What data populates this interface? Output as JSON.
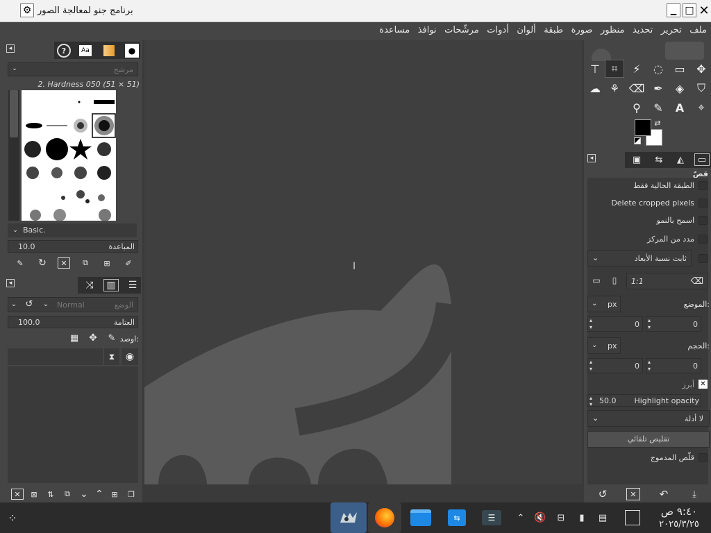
{
  "window": {
    "title": "برنامج جنو لمعالجة الصور"
  },
  "menu": [
    "ملف",
    "تحرير",
    "تحديد",
    "منظور",
    "صورة",
    "طبقة",
    "ألوان",
    "أدوات",
    "مرشّحات",
    "نوافذ",
    "مساعدة"
  ],
  "brushes": {
    "filter_placeholder": "مرشح",
    "selected_name": "2. Hardness 050 (51 × 51)",
    "preset": "Basic.",
    "spacing_label": "المباعدة",
    "spacing_value": "10.0"
  },
  "layers": {
    "mode_placeholder": "الوضع",
    "mode_value": "Normal",
    "opacity_label": "العتامة",
    "opacity_value": "100.0",
    "lock_label": "اوصد:"
  },
  "tool_options": {
    "title": "قصّ",
    "current_layer_only": "الطبقة الحالية فقط",
    "delete_cropped": "Delete cropped pixels",
    "allow_growing": "اسمح بالنمو",
    "expand_center": "مدد من المركز",
    "fixed_label": "ثابت نسبة الأبعاد",
    "ratio_value": "1:1",
    "position_label": "الموضع:",
    "size_label": "الحجم:",
    "unit": "px",
    "pos_x": "0",
    "pos_y": "0",
    "size_w": "0",
    "size_h": "0",
    "highlight_label": "أبرز",
    "highlight_opacity_label": "Highlight opacity",
    "highlight_opacity_value": "50.0",
    "guides": "لا أدلة",
    "auto_shrink": "تقليص تلقائي",
    "shrink_merged": "قلّص المدموج"
  },
  "taskbar": {
    "time": "٩:٤٠ ص",
    "date": "٢٠٢٥/٣/٢٥"
  },
  "colors": {
    "fg": "#000000",
    "bg": "#ffffff",
    "panel": "#454545",
    "canvas": "#3f3f3f"
  }
}
